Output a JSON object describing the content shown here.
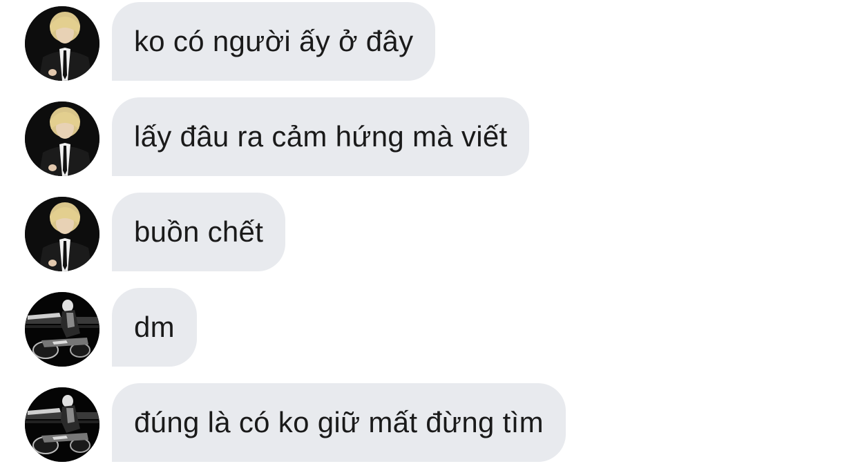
{
  "messages": [
    {
      "text": "ko có người ấy ở đây",
      "avatar": "blond-man-suit-avatar"
    },
    {
      "text": "lấy đâu ra cảm hứng mà viết",
      "avatar": "blond-man-suit-avatar"
    },
    {
      "text": "buồn chết",
      "avatar": "blond-man-suit-avatar"
    },
    {
      "text": "dm",
      "avatar": "motorcycle-night-avatar"
    },
    {
      "text": "đúng là có ko giữ mất đừng tìm",
      "avatar": "motorcycle-night-avatar"
    }
  ],
  "colors": {
    "bubble_bg": "#e8eaee",
    "text": "#1a1a1a",
    "page_bg": "#ffffff"
  }
}
